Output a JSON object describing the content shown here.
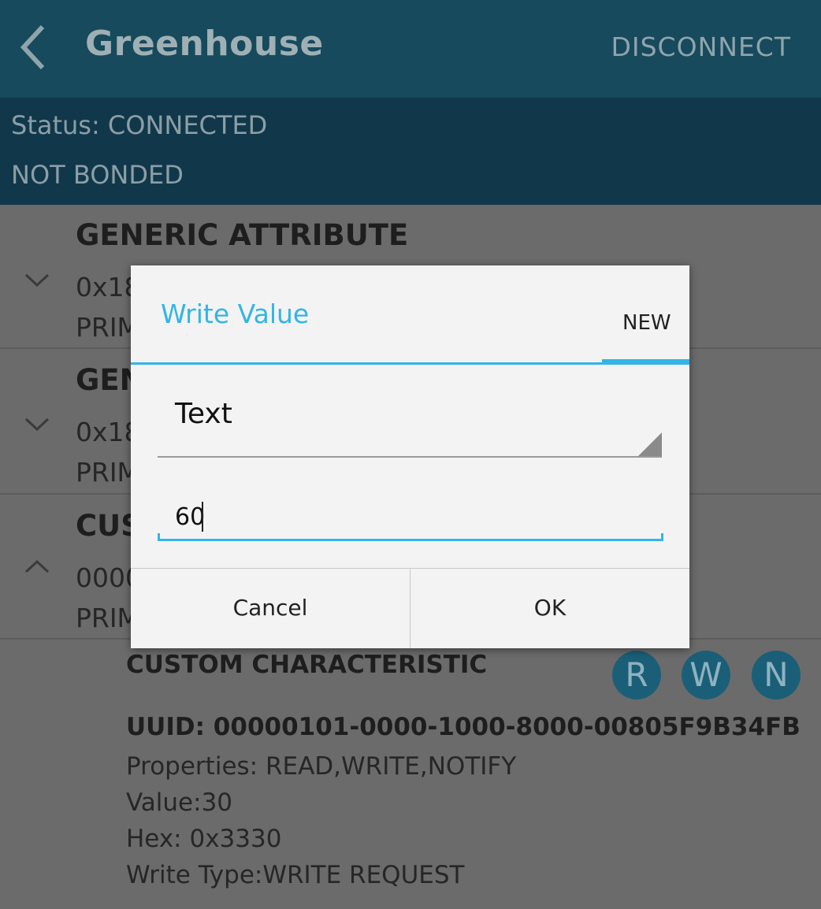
{
  "appbar": {
    "title": "Greenhouse",
    "action": "DISCONNECT",
    "colors": {
      "background": "#164a5c"
    }
  },
  "status": {
    "line1": "Status: CONNECTED",
    "line2": "NOT BONDED"
  },
  "services": [
    {
      "title": "GENERIC ATTRIBUTE",
      "line1": "0x18",
      "line2": "PRIM",
      "chevron": "chevron-down-icon"
    },
    {
      "title": "GEN",
      "line1": "0x18",
      "line2": "PRIM",
      "chevron": "chevron-down-icon"
    },
    {
      "title": "CUS",
      "line1": "0000",
      "line2": "PRIM",
      "chevron": "chevron-up-icon"
    }
  ],
  "characteristic": {
    "title": "CUSTOM CHARACTERISTIC",
    "uuid": "UUID: 00000101-0000-1000-8000-00805F9B34FB",
    "properties": "Properties: READ,WRITE,NOTIFY",
    "value": "Value:30",
    "hex": "Hex: 0x3330",
    "write_type": "Write Type:WRITE REQUEST",
    "badges": [
      "R",
      "W",
      "N"
    ]
  },
  "dialog": {
    "title": "Write Value",
    "tab": "NEW",
    "format_selected": "Text",
    "input_value": "60",
    "cancel": "Cancel",
    "ok": "OK",
    "accent": "#33b5e5"
  }
}
